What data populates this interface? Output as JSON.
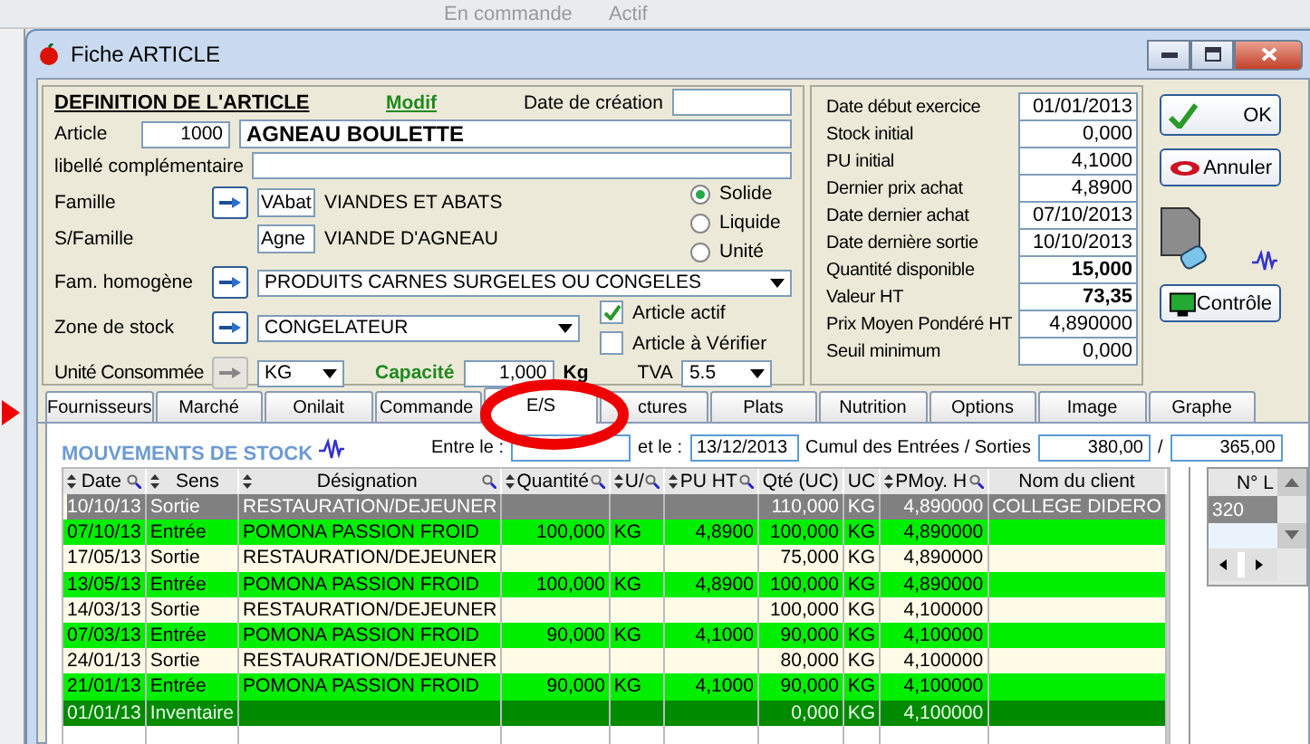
{
  "background_window": {
    "texts": [
      "En commande",
      "Actif"
    ]
  },
  "window": {
    "title": "Fiche ARTICLE"
  },
  "definition": {
    "heading": "DEFINITION DE L'ARTICLE",
    "mode": "Modif",
    "creation_date_label": "Date de création",
    "article_label": "Article",
    "article_number": "1000",
    "article_name": "AGNEAU BOULETTE",
    "extra_label_label": "libellé complémentaire",
    "family_label": "Famille",
    "family_code": "VAbat",
    "family_name": "VIANDES ET ABATS",
    "subfamily_label": "S/Famille",
    "subfamily_code": "Agne",
    "subfamily_name": "VIANDE D'AGNEAU",
    "states": [
      {
        "label": "Solide",
        "selected": true
      },
      {
        "label": "Liquide",
        "selected": false
      },
      {
        "label": "Unité",
        "selected": false
      }
    ],
    "homogeneous_family_label": "Fam. homogène",
    "homogeneous_family": "PRODUITS CARNES SURGELES OU CONGELES",
    "stock_zone_label": "Zone de stock",
    "stock_zone": "CONGELATEUR",
    "flags": [
      {
        "label": "Article actif",
        "checked": true
      },
      {
        "label": "Article à Vérifier",
        "checked": false
      }
    ],
    "unit_label": "Unité Consommée",
    "unit": "KG",
    "capacity_label": "Capacité",
    "capacity": "1,000",
    "capacity_unit": "Kg",
    "vat_label": "TVA",
    "vat": "5.5"
  },
  "stats": [
    {
      "label": "Date début exercice",
      "value": "01/01/2013",
      "bold": false
    },
    {
      "label": "Stock initial",
      "value": "0,000",
      "bold": false
    },
    {
      "label": "PU initial",
      "value": "4,1000",
      "bold": false
    },
    {
      "label": "Dernier prix achat",
      "value": "4,8900",
      "bold": false
    },
    {
      "label": "Date dernier achat",
      "value": "07/10/2013",
      "bold": false
    },
    {
      "label": "Date dernière sortie",
      "value": "10/10/2013",
      "bold": false
    },
    {
      "label": "Quantité disponible",
      "value": "15,000",
      "bold": true
    },
    {
      "label": "Valeur HT",
      "value": "73,35",
      "bold": true
    },
    {
      "label": "Prix Moyen Pondéré HT",
      "value": "4,890000",
      "bold": false
    },
    {
      "label": "Seuil minimum",
      "value": "0,000",
      "bold": false
    }
  ],
  "buttons": [
    {
      "label": "OK",
      "kind": "ok"
    },
    {
      "label": "Annuler",
      "kind": "cancel"
    },
    {
      "label": "Contrôle",
      "kind": "control"
    }
  ],
  "tabs": [
    {
      "label": "Fournisseurs",
      "selected": false
    },
    {
      "label": "Marché",
      "selected": false
    },
    {
      "label": "Onilait",
      "selected": false
    },
    {
      "label": "Commande",
      "selected": false
    },
    {
      "label": "E/S",
      "selected": true
    },
    {
      "label": "ctures",
      "selected": false
    },
    {
      "label": "Plats",
      "selected": false
    },
    {
      "label": "Nutrition",
      "selected": false
    },
    {
      "label": "Options",
      "selected": false
    },
    {
      "label": "Image",
      "selected": false
    },
    {
      "label": "Graphe",
      "selected": false
    }
  ],
  "movements": {
    "title": "MOUVEMENTS DE STOCK",
    "from_label": "Entre le :",
    "to_label": "et le :",
    "to_date": "13/12/2013",
    "cumul_label": "Cumul des Entrées / Sorties",
    "cumul_in": "380,00",
    "separator": "/",
    "cumul_out": "365,00",
    "columns": [
      "Date",
      "Sens",
      "Désignation",
      "Quantité",
      "U/",
      "PU HT",
      "Qté (UC)",
      "UC",
      "PMoy. H",
      "Nom du client"
    ],
    "rows": [
      {
        "kind": "sortie",
        "selected": true,
        "cells": [
          "10/10/13",
          "Sortie",
          "RESTAURATION/DEJEUNER",
          "",
          "",
          "",
          "110,000",
          "KG",
          "4,890000",
          "COLLEGE DIDERO"
        ]
      },
      {
        "kind": "entree",
        "selected": false,
        "cells": [
          "07/10/13",
          "Entrée",
          "POMONA PASSION FROID",
          "100,000",
          "KG",
          "4,8900",
          "100,000",
          "KG",
          "4,890000",
          ""
        ]
      },
      {
        "kind": "sortie",
        "selected": false,
        "cells": [
          "17/05/13",
          "Sortie",
          "RESTAURATION/DEJEUNER",
          "",
          "",
          "",
          "75,000",
          "KG",
          "4,890000",
          ""
        ]
      },
      {
        "kind": "entree",
        "selected": false,
        "cells": [
          "13/05/13",
          "Entrée",
          "POMONA PASSION FROID",
          "100,000",
          "KG",
          "4,8900",
          "100,000",
          "KG",
          "4,890000",
          ""
        ]
      },
      {
        "kind": "sortie",
        "selected": false,
        "cells": [
          "14/03/13",
          "Sortie",
          "RESTAURATION/DEJEUNER",
          "",
          "",
          "",
          "100,000",
          "KG",
          "4,100000",
          ""
        ]
      },
      {
        "kind": "entree",
        "selected": false,
        "cells": [
          "07/03/13",
          "Entrée",
          "POMONA PASSION FROID",
          "90,000",
          "KG",
          "4,1000",
          "90,000",
          "KG",
          "4,100000",
          ""
        ]
      },
      {
        "kind": "sortie",
        "selected": false,
        "cells": [
          "24/01/13",
          "Sortie",
          "RESTAURATION/DEJEUNER",
          "",
          "",
          "",
          "80,000",
          "KG",
          "4,100000",
          ""
        ]
      },
      {
        "kind": "entree",
        "selected": false,
        "cells": [
          "21/01/13",
          "Entrée",
          "POMONA PASSION FROID",
          "90,000",
          "KG",
          "4,1000",
          "90,000",
          "KG",
          "4,100000",
          ""
        ]
      },
      {
        "kind": "inventaire",
        "selected": false,
        "cells": [
          "01/01/13",
          "Inventaire",
          "",
          "",
          "",
          "",
          "0,000",
          "KG",
          "4,100000",
          ""
        ]
      }
    ]
  },
  "lots": {
    "column": "N° L",
    "rows": [
      "320"
    ]
  }
}
